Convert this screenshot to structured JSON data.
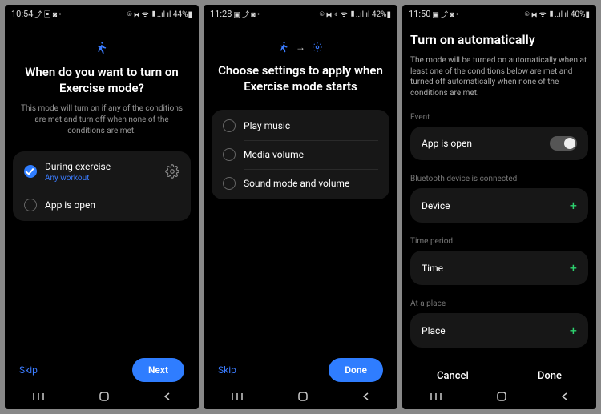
{
  "screen1": {
    "status": {
      "time": "10:54",
      "icons_left": "⤴ ▣ ◙ •",
      "icons_right": "⌾ ⧓ ᯤ ▮..ıl ıl 44%▮"
    },
    "title": "When do you want to turn on Exercise mode?",
    "desc": "This mode will turn on if any of the conditions are met and turn off when none of the conditions are met.",
    "options": [
      {
        "label": "During exercise",
        "sub": "Any workout",
        "checked": true,
        "gear": true
      },
      {
        "label": "App is open",
        "checked": false
      }
    ],
    "skip": "Skip",
    "next": "Next"
  },
  "screen2": {
    "status": {
      "time": "11:28",
      "icons_left": "▣ ⤴ ◙ •",
      "icons_right": "⌾ ⧓ ⌖ ᯤ ▮..ıl ıl 42%▮"
    },
    "title": "Choose settings to apply when Exercise mode starts",
    "options": [
      {
        "label": "Play music"
      },
      {
        "label": "Media volume"
      },
      {
        "label": "Sound mode and volume"
      }
    ],
    "skip": "Skip",
    "done": "Done"
  },
  "screen3": {
    "status": {
      "time": "11:50",
      "icons_left": "▣ ⤴ ◙ •",
      "icons_right": "⌾ ⧓ ᯤ ▮..ıl ıl 40%▮"
    },
    "title": "Turn on automatically",
    "desc": "The mode will be turned on automatically when at least one of the conditions below are met and turned off automatically when none of the conditions are met.",
    "sections": {
      "event": {
        "label": "Event",
        "item": "App is open"
      },
      "bluetooth": {
        "label": "Bluetooth device is connected",
        "item": "Device"
      },
      "time": {
        "label": "Time period",
        "item": "Time"
      },
      "place": {
        "label": "At a place",
        "item": "Place"
      }
    },
    "cancel": "Cancel",
    "done": "Done"
  }
}
